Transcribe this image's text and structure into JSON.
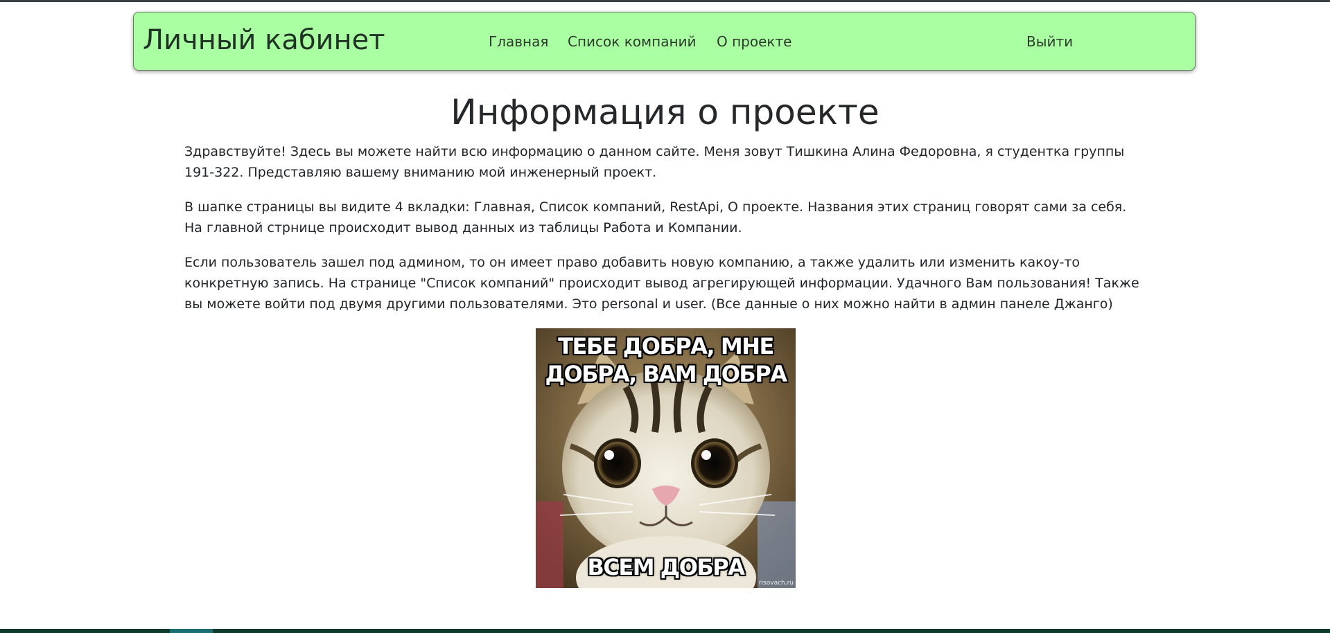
{
  "colors": {
    "navbar_bg": "#abffa3",
    "text": "#212529",
    "footer": "#0d3b2c"
  },
  "navbar": {
    "brand": "Личный кабинет",
    "links": [
      {
        "label": "Главная"
      },
      {
        "label": "Список компаний"
      },
      {
        "label": "О проекте"
      }
    ],
    "logout": "Выйти"
  },
  "main": {
    "title": "Информация о проекте",
    "paragraphs": [
      "Здравствуйте! Здесь вы можете найти всю информацию о данном сайте. Меня зовут Тишкина Алина Федоровна, я студентка группы 191-322. Представляю вашему вниманию мой инженерный проект.",
      "В шапке страницы вы видите 4 вкладки: Главная, Список компаний, RestApi, О проекте. Названия этих страниц говорят сами за себя. На главной стрнице происходит вывод данных из таблицы Работа и Компании.",
      "Если пользователь зашел под админом, то он имеет право добавить новую компанию, а также удалить или изменить какоу-то конкретную запись. На странице \"Список компаний\" происходит вывод агрегирующей информации. Удачного Вам пользования! Также вы можете войти под двумя другими пользователями. Это personal и user. (Все данные о них можно найти в админ панеле Джанго)"
    ],
    "image": {
      "caption_top_line1": "ТЕБЕ ДОБРА, МНЕ",
      "caption_top_line2": "ДОБРА, ВАМ ДОБРА",
      "caption_bottom": "ВСЕМ ДОБРА",
      "watermark": "risovach.ru"
    }
  }
}
